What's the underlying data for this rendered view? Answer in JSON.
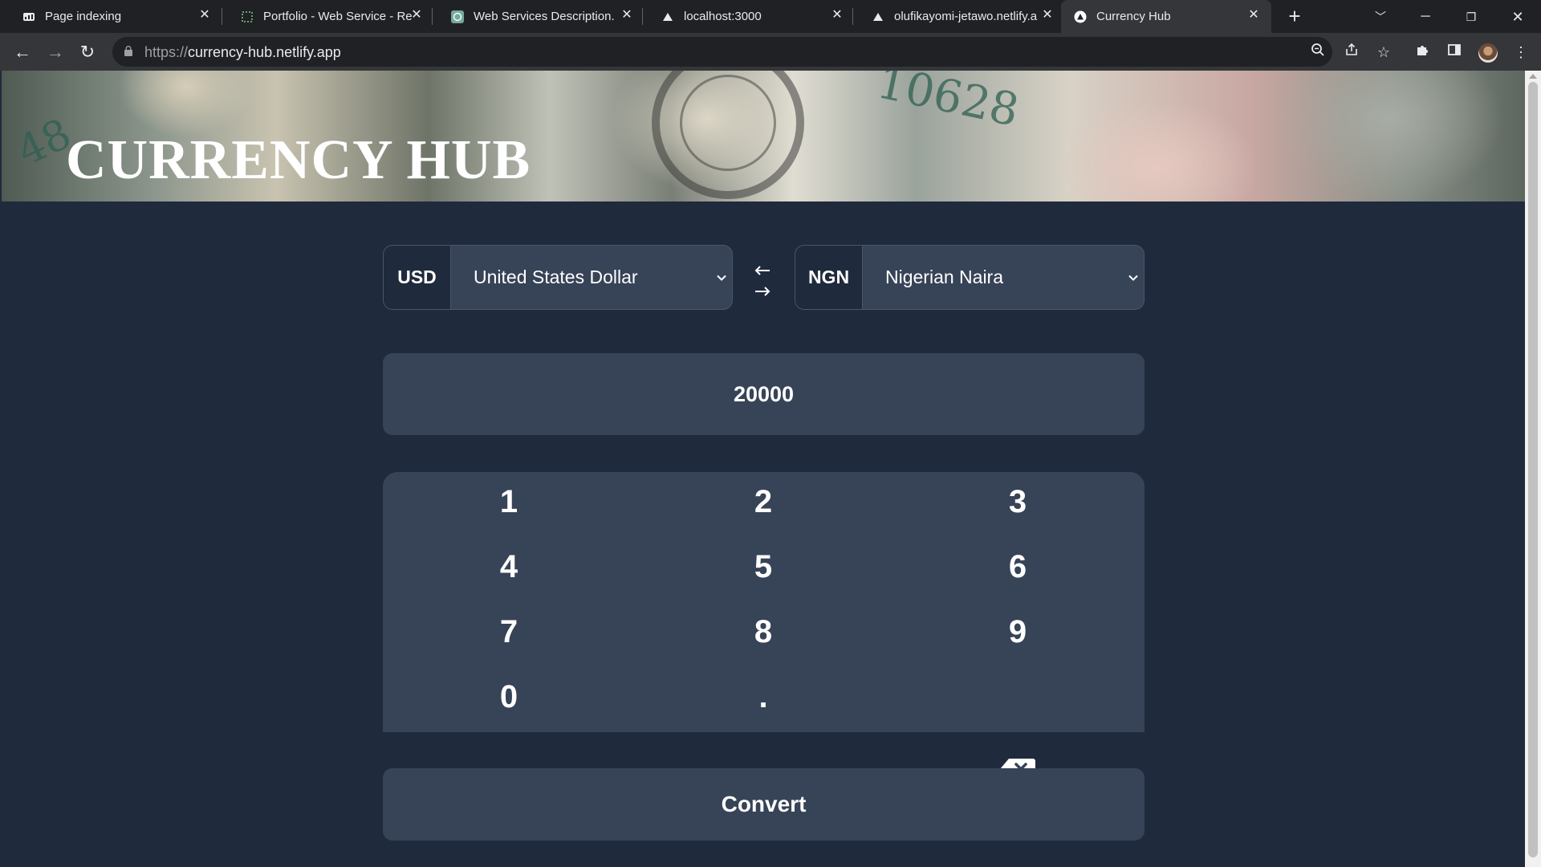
{
  "browser": {
    "tabs": [
      {
        "title": "Page indexing",
        "favicon": "google-search-console-icon"
      },
      {
        "title": "Portfolio - Web Service - Re",
        "favicon": "dotted-square-icon"
      },
      {
        "title": "Web Services Description.",
        "favicon": "chatgpt-icon"
      },
      {
        "title": "localhost:3000",
        "favicon": "triangle-icon"
      },
      {
        "title": "olufikayomi-jetawo.netlify.a",
        "favicon": "triangle-icon"
      },
      {
        "title": "Currency Hub",
        "favicon": "triangle-icon",
        "active": true
      }
    ],
    "url_scheme": "https://",
    "url_host": "currency-hub.netlify.app"
  },
  "app": {
    "title": "CURRENCY HUB",
    "from": {
      "code": "USD",
      "name": "United States Dollar"
    },
    "to": {
      "code": "NGN",
      "name": "Nigerian Naira"
    },
    "amount": "20000",
    "keys": [
      "1",
      "2",
      "3",
      "4",
      "5",
      "6",
      "7",
      "8",
      "9",
      "0",
      "."
    ],
    "convert_label": "Convert"
  },
  "colors": {
    "page_bg": "#1f2a3c",
    "panel_bg": "#374357",
    "text": "#ffffff"
  }
}
